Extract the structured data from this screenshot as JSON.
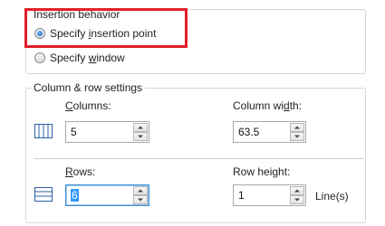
{
  "insertion": {
    "legend": "Insertion behavior",
    "options": [
      {
        "label_prefix": "Specify ",
        "label_underlined": "i",
        "label_suffix": "nsertion point",
        "checked": true
      },
      {
        "label_prefix": "Specify ",
        "label_underlined": "w",
        "label_suffix": "indow",
        "checked": false
      }
    ]
  },
  "settings": {
    "legend": "Column & row settings",
    "columns": {
      "label_underlined": "C",
      "label_rest": "olumns:",
      "value": "5"
    },
    "column_width": {
      "label_prefix": "Column wi",
      "label_underlined": "d",
      "label_suffix": "th:",
      "value": "63.5"
    },
    "rows": {
      "label_underlined": "R",
      "label_rest": "ows:",
      "value": "6"
    },
    "row_height": {
      "label_prefix": "Row hei",
      "label_underlined": "g",
      "label_suffix": "ht:",
      "value": "1",
      "unit": "Line(s)"
    }
  },
  "colors": {
    "highlight": "#e0202a",
    "icon_blue": "#2b5fa6",
    "focus": "#3b8fd8"
  },
  "icons": {
    "columns": "columns-icon",
    "rows": "rows-icon"
  }
}
